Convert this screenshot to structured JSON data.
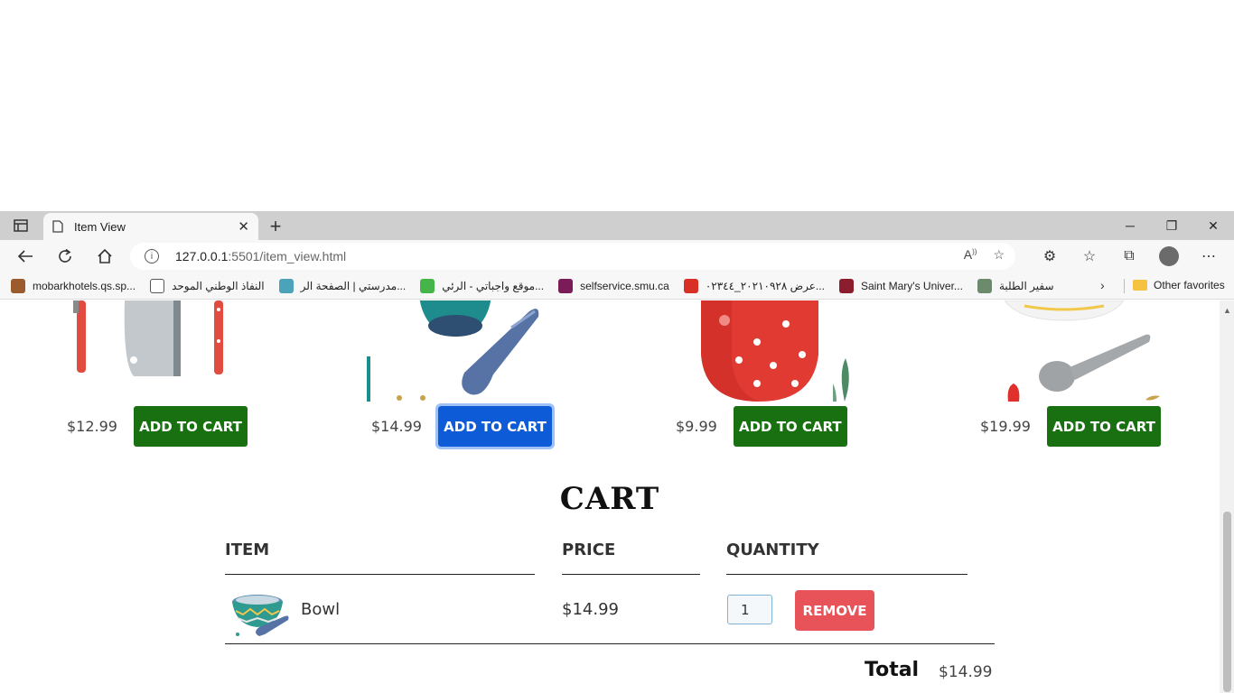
{
  "browser": {
    "tab_title": "Item View",
    "url_host": "127.0.0.1",
    "url_rest": ":5501/item_view.html",
    "bookmarks": [
      {
        "label": "mobarkhotels.qs.sp...",
        "color": "#9b5b2c"
      },
      {
        "label": "النفاذ الوطني الموحد",
        "color": "#ffffff"
      },
      {
        "label": "مدرستي | الصفحة الر...",
        "color": "#4aa3b8"
      },
      {
        "label": "موقع واجباتي - الرئي...",
        "color": "#45b54a"
      },
      {
        "label": "selfservice.smu.ca",
        "color": "#7a1c58"
      },
      {
        "label": "عرض ٢٠٢١٠٩٢٨_٠٢٣٤٤...",
        "color": "#d93025"
      },
      {
        "label": "Saint Mary's Univer...",
        "color": "#8c1d2f"
      },
      {
        "label": "سفير الطلبة",
        "color": "#6c8a6c"
      }
    ],
    "other_favorites": "Other favorites"
  },
  "products": [
    {
      "price": "$12.99",
      "button": "ADD TO CART",
      "icon": "knife-set-image"
    },
    {
      "price": "$14.99",
      "button": "ADD TO CART",
      "icon": "bowl-spoon-image"
    },
    {
      "price": "$9.99",
      "button": "ADD TO CART",
      "icon": "strawberry-image"
    },
    {
      "price": "$19.99",
      "button": "ADD TO CART",
      "icon": "plate-spoon-image"
    }
  ],
  "cart": {
    "title": "CART",
    "headers": {
      "item": "ITEM",
      "price": "PRICE",
      "quantity": "QUANTITY"
    },
    "rows": [
      {
        "name": "Bowl",
        "price": "$14.99",
        "quantity": "1",
        "remove": "REMOVE"
      }
    ],
    "total_label": "Total",
    "total_value": "$14.99"
  },
  "colors": {
    "add_to_cart": "#197010",
    "add_to_cart_focused": "#0d5bd6",
    "remove": "#e8535a"
  }
}
